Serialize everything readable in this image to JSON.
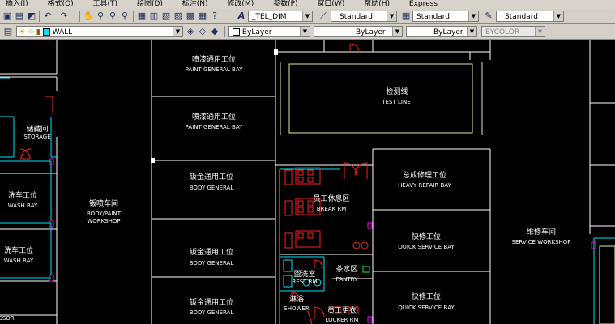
{
  "menu": [
    "插入(I)",
    "格式(O)",
    "工具(T)",
    "绘图(D)",
    "标注(N)",
    "修改(M)",
    "参数(P)",
    "窗口(W)",
    "帮助(H)",
    "Express"
  ],
  "toolbar_styles": {
    "dim_style": "_TEL_DIM",
    "text_style": "Standard",
    "table_style": "Standard",
    "multileader_style": "Standard"
  },
  "layers": {
    "current_layer": "WALL",
    "color": "ByLayer",
    "linetype": "ByLayer",
    "lineweight": "ByLayer",
    "plotstyle": "BYCOLOR"
  },
  "drawing": {
    "labels": [
      {
        "cn": "喷漆通用工位",
        "en": "PAINT GENERAL BAY"
      },
      {
        "cn": "喷漆通用工位",
        "en": "PAINT GENERAL BAY"
      },
      {
        "cn": "检测线",
        "en": "TEST LINE"
      },
      {
        "cn": "储藏间",
        "en": "STORAGE"
      },
      {
        "cn": "钣金通用工位",
        "en": "BODY GENERAL"
      },
      {
        "cn": "员工休息区",
        "en": "BREAK RM"
      },
      {
        "cn": "总成修理工位",
        "en": "HEAVY REPAIR BAY"
      },
      {
        "cn": "洗车工位",
        "en": "WASH BAY"
      },
      {
        "cn": "钣喷车间",
        "en": "BODY/PAINT",
        "en2": "WORKSHOP"
      },
      {
        "cn": "洗车工位",
        "en": "WASH BAY"
      },
      {
        "cn": "快修工位",
        "en": "QUICK SERVICE BAY"
      },
      {
        "cn": "维修车间",
        "en": "SERVICE WORKSHOP"
      },
      {
        "cn": "钣金通用工位",
        "en": "BODY GENERAL"
      },
      {
        "cn": "茶水区",
        "en": "PANTRY"
      },
      {
        "cn": "盥洗室",
        "en": "REST RM"
      },
      {
        "cn": "淋浴",
        "en": "SHOWER"
      },
      {
        "cn": "员工更衣",
        "en": "LOCKER RM"
      },
      {
        "cn": "钣金通用工位",
        "en": "BODY GENERAL"
      },
      {
        "cn": "快修工位",
        "en": "QUICK SERVICE BAY"
      }
    ],
    "partial_text": "SSOR"
  },
  "colors": {
    "toolbar_bg": "#d4d0c8",
    "canvas_bg": "#000000",
    "wall": "#ffffff",
    "room_outline": "#e8e8a0",
    "cyan": "#00e5ff",
    "red": "#ff2020",
    "magenta": "#ff00ff"
  }
}
